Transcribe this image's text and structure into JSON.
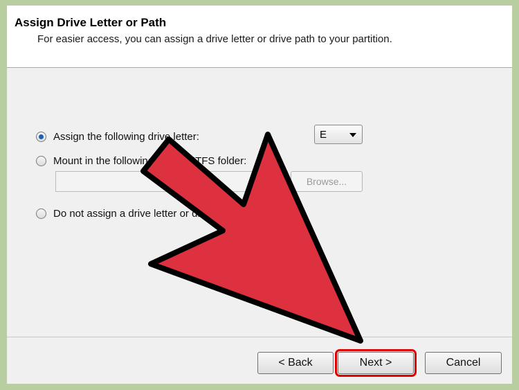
{
  "wizard": {
    "title": "Assign Drive Letter or Path",
    "subtitle": "For easier access, you can assign a drive letter or drive path to your partition."
  },
  "options": {
    "assign_letter": {
      "label": "Assign the following drive letter:",
      "selected": true
    },
    "mount_folder": {
      "label": "Mount in the following empty NTFS folder:",
      "selected": false
    },
    "no_assign": {
      "label": "Do not assign a drive letter or drive path",
      "selected": false
    }
  },
  "drive_letter": {
    "value": "E"
  },
  "folder_path": {
    "value": ""
  },
  "browse_button": {
    "label": "Browse..."
  },
  "buttons": {
    "back": "< Back",
    "next": "Next >",
    "cancel": "Cancel"
  },
  "overlay": {
    "arrow_color": "#de3140",
    "highlight_color": "#e00000"
  }
}
